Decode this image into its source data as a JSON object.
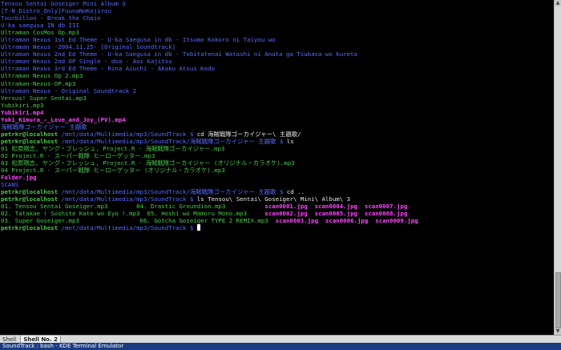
{
  "terminal": {
    "lines": [
      [
        {
          "t": "Tensou Sentai Goseiger Mini Album 3",
          "c": "blue"
        }
      ],
      [
        {
          "t": "[T-N_Distro_Only]FuunaNoKojirou",
          "c": "blue"
        }
      ],
      [
        {
          "t": "Tourbillon - Break the Chain",
          "c": "blue"
        }
      ],
      [
        {
          "t": "U-ka saegusa IN db III",
          "c": "blue"
        }
      ],
      [
        {
          "t": "Ultraman CosMos Op.mp3",
          "c": "green"
        }
      ],
      [
        {
          "t": "Ultraman Nexus 1st Ed Theme - U-ka Saegusa in db - Itsumo Kokoro ni Taiyou wo",
          "c": "blue"
        }
      ],
      [
        {
          "t": "Ultraman Nexus -2004.11.25- [Original Soundtrack]",
          "c": "blue"
        }
      ],
      [
        {
          "t": "Ultraman Nexus 2nd Ed Theme - U-ka Saegusa in db - Tobitatenai Watashi ni Anata ga Tsubasa wo kureta",
          "c": "blue"
        }
      ],
      [
        {
          "t": "Ultraman Nexus 2nd OP Single - doa - Aoi Kajitsu",
          "c": "blue"
        }
      ],
      [
        {
          "t": "Ultraman Nexus 3rd Ed Theme - Rina Aiuchi - Akaku Atsui Kodo",
          "c": "blue"
        }
      ],
      [
        {
          "t": "Ultraman Nexus Op 2.mp3",
          "c": "green"
        }
      ],
      [
        {
          "t": "Ultraman-Nexus-OP.mp3",
          "c": "green"
        }
      ],
      [
        {
          "t": "Ultraman Nexus - Original Soundtrack 2",
          "c": "blue"
        }
      ],
      [
        {
          "t": "Versus! Super Sentai.mp3",
          "c": "green"
        }
      ],
      [
        {
          "t": "Yubikiri.mp3",
          "c": "green"
        }
      ],
      [
        {
          "t": "Yubikiri.mp4",
          "c": "magenta",
          "b": true
        }
      ],
      [
        {
          "t": "Yuki_Kimura_-_Love_and_Joy_(PV).mp4",
          "c": "magenta",
          "b": true
        }
      ],
      [
        {
          "t": "海賊戦隊ゴーカイジャー 主題歌",
          "c": "blue"
        }
      ],
      [
        {
          "t": "petrkr@localhost",
          "c": "green",
          "b": true
        },
        {
          "t": " /mnt/data/Multimedia/mp3/SoundTrack $ ",
          "c": "blue"
        },
        {
          "t": "cd 海賊戦隊ゴーカイジャー\\ 主題歌/",
          "c": "white"
        }
      ],
      [
        {
          "t": "petrkr@localhost",
          "c": "green",
          "b": true
        },
        {
          "t": " /mnt/data/Multimedia/mp3/SoundTrack/海賊戦隊ゴーカイジャー 主題歌 $ ",
          "c": "blue"
        },
        {
          "t": "ls",
          "c": "white"
        }
      ],
      [
        {
          "t": "01 松原剛志, ヤング・フレッシュ, Project.R - 海賊戦隊ゴーカイジャー.mp3",
          "c": "green"
        }
      ],
      [
        {
          "t": "02 Project.R - スーパー戦隊 ヒーローゲッター.mp3",
          "c": "green"
        }
      ],
      [
        {
          "t": "03 松原剛志, ヤング・フレッシュ, Project.R - 海賊戦隊ゴーカイジャー (オリジナル・カラオケ).mp3",
          "c": "green"
        }
      ],
      [
        {
          "t": "04 Project.R - スーパー戦隊 ヒーローゲッター (オリジナル・カラオケ).mp3",
          "c": "green"
        }
      ],
      [
        {
          "t": "Folder.jpg",
          "c": "magenta",
          "b": true
        }
      ],
      [
        {
          "t": "SCANS",
          "c": "blue"
        }
      ],
      [
        {
          "t": "petrkr@localhost",
          "c": "green",
          "b": true
        },
        {
          "t": " /mnt/data/Multimedia/mp3/SoundTrack/海賊戦隊ゴーカイジャー 主題歌 $ ",
          "c": "blue"
        },
        {
          "t": "cd ..",
          "c": "white"
        }
      ],
      [
        {
          "t": "petrkr@localhost",
          "c": "green",
          "b": true
        },
        {
          "t": " /mnt/data/Multimedia/mp3/SoundTrack $ ",
          "c": "blue"
        },
        {
          "t": "ls Tensou\\ Sentai\\ Goseiger\\ Mini\\ Album\\ 3",
          "c": "white"
        }
      ],
      [
        {
          "t": "01. Tensou Sentai Goseiger.mp3        04. Drastic Groundion.mp3           ",
          "c": "green"
        },
        {
          "t": "scan0001.jpg  scan0004.jpg  scan0007.jpg",
          "c": "magenta",
          "b": true
        }
      ],
      [
        {
          "t": "02. Tatakae ! Soshite Kate wo Eyo !.mp3  05. Hoshi wo Mamoru Mono.mp3     ",
          "c": "green"
        },
        {
          "t": "scan0002.jpg  scan0005.jpg  scan0008.jpg",
          "c": "magenta",
          "b": true
        }
      ],
      [
        {
          "t": "03. Super Goseiger.mp3                 06. Gotcha Goseiger TYPE 2 REMIX.mp3  ",
          "c": "green"
        },
        {
          "t": "scan0003.jpg  scan0006.jpg  scan0009.jpg",
          "c": "magenta",
          "b": true
        }
      ],
      [
        {
          "t": "petrkr@localhost",
          "c": "green",
          "b": true
        },
        {
          "t": " /mnt/data/Multimedia/mp3/SoundTrack $ ",
          "c": "blue"
        }
      ]
    ]
  },
  "tabs": [
    {
      "label": "Shell",
      "active": false
    },
    {
      "label": "Shell No. 2",
      "active": true
    }
  ],
  "window": {
    "title": "SoundTrack : bash - KDE Terminal Emulator"
  }
}
